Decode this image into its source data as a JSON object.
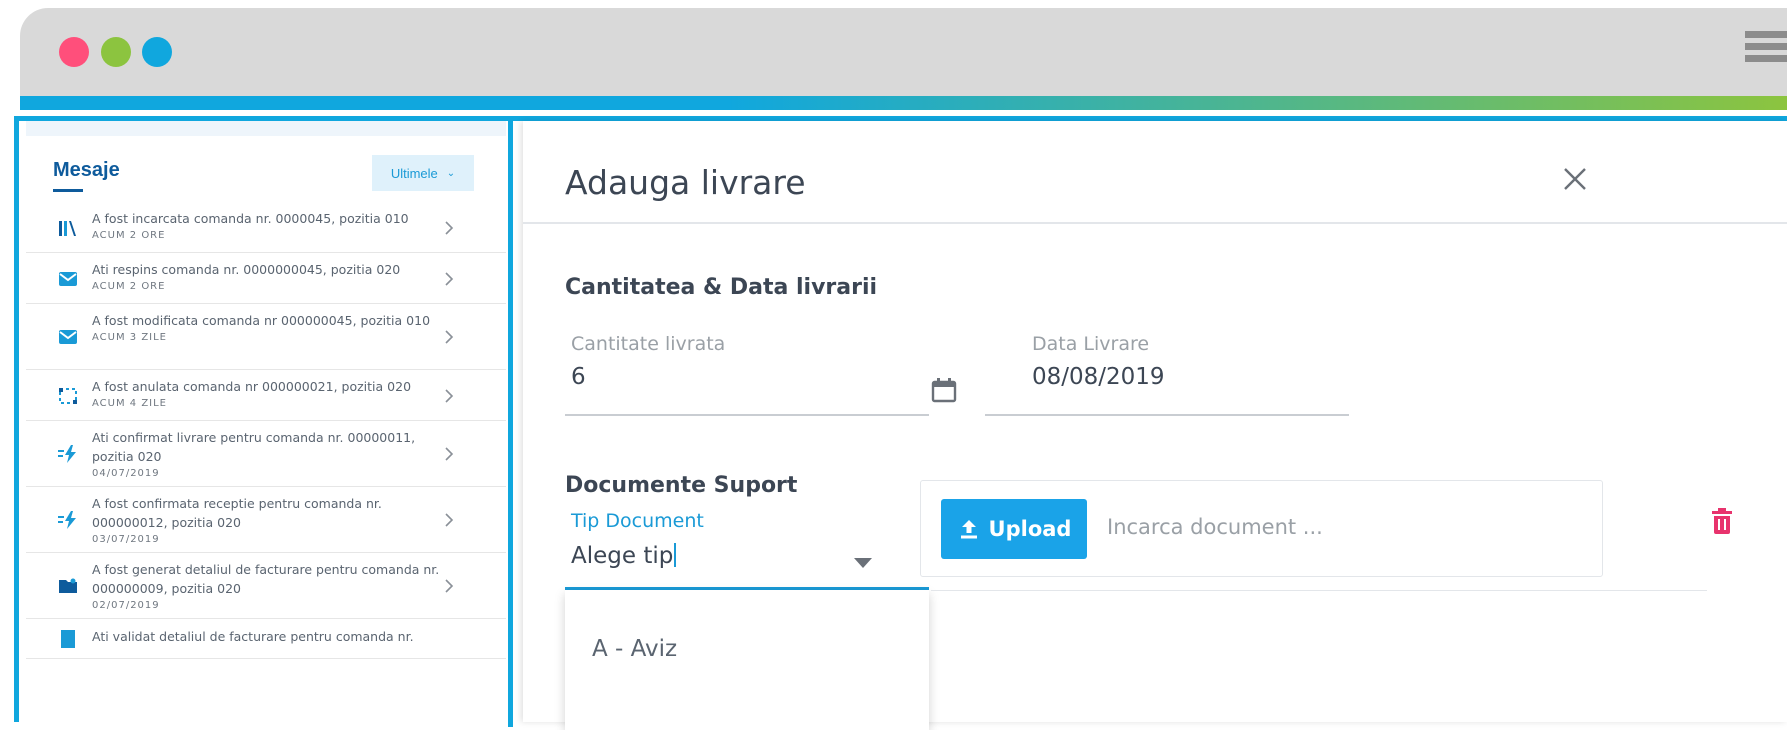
{
  "window": {
    "traffic_lights": {
      "red": "#ff4f7b",
      "green": "#8cc43f",
      "blue": "#10a7de"
    },
    "menu_icon": "hamburger-icon",
    "accent_colors": [
      "#10a7de",
      "#8cc43f"
    ]
  },
  "sidebar": {
    "title": "Mesaje",
    "filter_label": "Ultimele",
    "filter_icon": "chevron-down-icon",
    "messages": [
      {
        "icon": "books-icon",
        "text": "A fost incarcata comanda nr. 0000045, pozitia 010",
        "time": "ACUM 2 ORE"
      },
      {
        "icon": "envelope-icon",
        "text": "Ati respins comanda nr. 0000000045, pozitia 020",
        "time": "ACUM 2 ORE"
      },
      {
        "icon": "envelope-icon",
        "text": "A fost modificata comanda nr 000000045, pozitia 010",
        "time": "ACUM 3 ZILE"
      },
      {
        "icon": "selection-icon",
        "text": "A fost anulata comanda nr 000000021, pozitia 020",
        "time": "ACUM 4 ZILE"
      },
      {
        "icon": "bolt-icon",
        "text": "Ati confirmat livrare pentru comanda nr. 00000011, pozitia 020",
        "time": "04/07/2019"
      },
      {
        "icon": "bolt-icon",
        "text": "A fost confirmata receptie pentru comanda nr. 000000012, pozitia 020",
        "time": "03/07/2019"
      },
      {
        "icon": "folder-icon",
        "text": "A fost generat detaliul de facturare pentru comanda nr. 000000009, pozitia 020",
        "time": "02/07/2019"
      },
      {
        "icon": "document-icon",
        "text": "Ati validat detaliul de facturare pentru comanda nr.",
        "time": ""
      }
    ]
  },
  "modal": {
    "title": "Adauga livrare",
    "close_icon": "close-icon",
    "section_quantity": "Cantitatea & Data livrarii",
    "quantity_label": "Cantitate livrata",
    "quantity_value": "6",
    "date_label": "Data Livrare",
    "date_value": "08/08/2019",
    "date_icon": "calendar-icon",
    "section_docs": "Documente Suport",
    "doc_type_label": "Tip Document",
    "doc_type_value": "Alege tip",
    "dropdown_options": [
      "A - Aviz"
    ],
    "upload_label": "Upload",
    "upload_icon": "upload-icon",
    "upload_placeholder": "Incarca document ...",
    "delete_icon": "trash-icon",
    "delete_color": "#e8336d"
  }
}
